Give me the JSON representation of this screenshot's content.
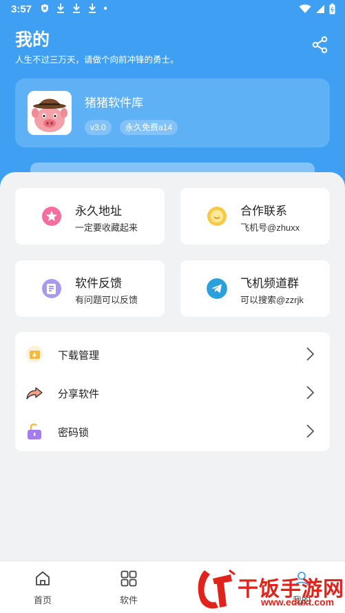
{
  "status_bar": {
    "time": "3:57"
  },
  "header": {
    "title": "我的",
    "subtitle": "人生不过三万天，请做个向前冲锋的勇士。"
  },
  "profile": {
    "app_name": "猪猪软件库",
    "version": "v3.0",
    "license": "永久免费a14"
  },
  "tiles": [
    {
      "title": "永久地址",
      "desc": "一定要收藏起来",
      "icon": "star-icon",
      "color": "#f46fa0"
    },
    {
      "title": "合作联系",
      "desc": "飞机号@zhuxx",
      "icon": "smile-icon",
      "color": "#f7c948"
    },
    {
      "title": "软件反馈",
      "desc": "有问题可以反馈",
      "icon": "feedback-icon",
      "color": "#8c7be8"
    },
    {
      "title": "飞机频道群",
      "desc": "可以搜索@zzrjk",
      "icon": "telegram-icon",
      "color": "#2aa0dc"
    }
  ],
  "menu": [
    {
      "label": "下载管理",
      "icon": "download-folder-icon"
    },
    {
      "label": "分享软件",
      "icon": "share-arrow-icon"
    },
    {
      "label": "密码锁",
      "icon": "lock-icon"
    }
  ],
  "bottom_nav": [
    {
      "label": "首页",
      "icon": "home-icon"
    },
    {
      "label": "软件",
      "icon": "grid-icon"
    },
    {
      "label": "我的",
      "icon": "user-icon"
    }
  ],
  "watermark": {
    "text": "干饭手游网",
    "url": "www.eduxt.com"
  },
  "colors": {
    "accent": "#3fa0f3",
    "background": "#f1f2f4"
  }
}
